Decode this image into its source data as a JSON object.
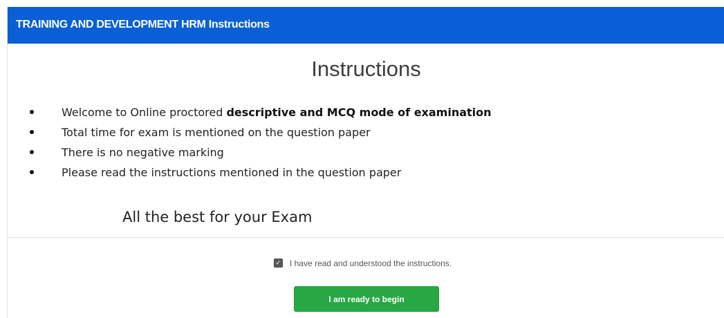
{
  "header": {
    "title": "TRAINING AND DEVELOPMENT HRM Instructions"
  },
  "main": {
    "heading": "Instructions",
    "instructions": [
      {
        "text": "Welcome to Online proctored ",
        "emphasis": "descriptive and MCQ mode of examination"
      },
      {
        "text": "Total time for exam is mentioned on the question paper"
      },
      {
        "text": "There is no negative marking"
      },
      {
        "text": "Please read the instructions mentioned in the question paper"
      }
    ],
    "wish": "All the best for your Exam"
  },
  "footer": {
    "confirm_checked": true,
    "confirm_label": "I have read and understood the instructions.",
    "begin_label": "I am ready to begin"
  },
  "colors": {
    "header_bg": "#0a5fd6",
    "button_bg": "#28a745"
  }
}
